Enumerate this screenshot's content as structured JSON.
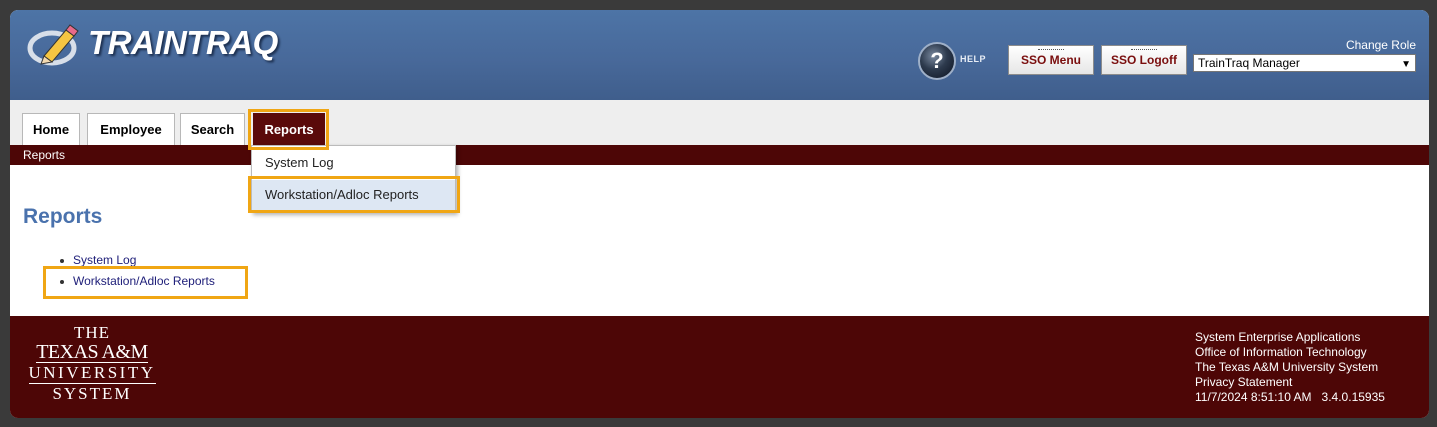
{
  "header": {
    "brand": "TRAINTRAQ",
    "help_label": "HELP",
    "sso_menu_label": "SSO Menu",
    "sso_logoff_label": "SSO Logoff",
    "change_role_label": "Change Role",
    "role_selected": "TrainTraq Manager"
  },
  "tabs": {
    "home": "Home",
    "employee": "Employee",
    "search": "Search",
    "reports": "Reports"
  },
  "breadcrumb": "Reports",
  "dropdown": {
    "items": [
      "System Log",
      "Workstation/Adloc Reports"
    ]
  },
  "main": {
    "title": "Reports",
    "links": [
      "System Log",
      "Workstation/Adloc Reports"
    ]
  },
  "footer": {
    "logo": {
      "line1": "THE",
      "line2": "TEXAS A&M",
      "line3": "UNIVERSITY",
      "line4": "SYSTEM"
    },
    "info": [
      "System Enterprise Applications",
      "Office of Information Technology",
      "The Texas A&M University System",
      "Privacy Statement",
      "11/7/2024 8:51:10 AM   3.4.0.15935"
    ]
  },
  "colors": {
    "header_blue": "#48699a",
    "maroon": "#4d0606",
    "highlight": "#f0a614",
    "title_blue": "#4a72ad"
  }
}
